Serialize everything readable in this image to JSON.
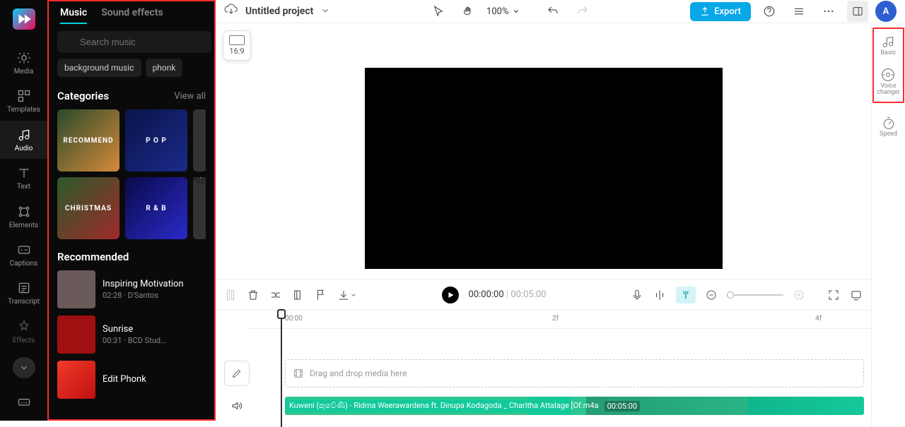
{
  "leftnav": {
    "items": [
      {
        "label": "Media",
        "name": "nav-media"
      },
      {
        "label": "Templates",
        "name": "nav-templates"
      },
      {
        "label": "Audio",
        "name": "nav-audio",
        "active": true
      },
      {
        "label": "Text",
        "name": "nav-text"
      },
      {
        "label": "Elements",
        "name": "nav-elements"
      },
      {
        "label": "Captions",
        "name": "nav-captions"
      },
      {
        "label": "Transcript",
        "name": "nav-transcript"
      },
      {
        "label": "Effects",
        "name": "nav-effects"
      }
    ]
  },
  "audiopanel": {
    "tabs": {
      "music": "Music",
      "sfx": "Sound effects"
    },
    "search_placeholder": "Search music",
    "chips": [
      "background music",
      "phonk"
    ],
    "categories_title": "Categories",
    "viewall": "View all",
    "cats": [
      {
        "label": "RECOMMEND",
        "bg": "linear-gradient(135deg,#2a4a2a,#8a4a1a)"
      },
      {
        "label": "P O P",
        "bg": "linear-gradient(135deg,#0a144a,#1a2a8a)"
      },
      {
        "label": "CHRISTMAS",
        "bg": "linear-gradient(135deg,#2a3a2a,#7a2a2a)"
      },
      {
        "label": "R & B",
        "bg": "linear-gradient(135deg,#0a0a4a,#2a2a9a)"
      }
    ],
    "rec_title": "Recommended",
    "recs": [
      {
        "title": "Inspiring Motivation",
        "meta": "02:28 · D'Santos",
        "thumb": "#6a5a5a"
      },
      {
        "title": "Sunrise",
        "meta": "00:31 · BCD Stud...",
        "thumb": "#a01010"
      },
      {
        "title": "Edit Phonk",
        "meta": "",
        "thumb": "#c01010"
      }
    ]
  },
  "topbar": {
    "title": "Untitled project",
    "zoom": "100%",
    "export": "Export",
    "avatar": "A"
  },
  "preview": {
    "aspect": "16:9"
  },
  "rightrail": {
    "basic": "Basic",
    "voice": "Voice\nchanger",
    "speed": "Speed"
  },
  "tltoolbar": {
    "current": "00:00:00",
    "duration": "00:05:00"
  },
  "timeline": {
    "tick0": "00:00",
    "tick1": "2f",
    "tick2": "4f",
    "placeholder": "Drag and drop media here",
    "clipname": "Kuweni (කුවේණි) - Ridma Weerawardena ft. Dinupa Kodagoda _ Charitha Attalage [Of.m4a",
    "clipdur": "00:05:00"
  }
}
